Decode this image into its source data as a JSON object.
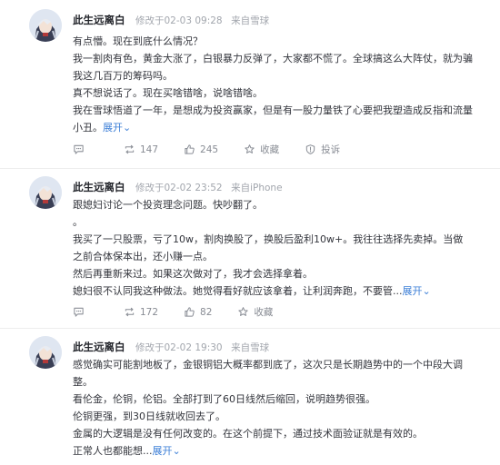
{
  "posts": [
    {
      "author": "此生远离白",
      "time": "修改于02-03 09:28",
      "source": "来自雪球",
      "lines": [
        "有点懵。现在到底什么情况？",
        "我一割肉有色，黄金大涨了，白银暴力反弹了，大家都不慌了。全球搞这么大阵仗，就为骗我这几百万的筹码吗。",
        "真不想说话了。现在买啥错啥，说啥错啥。",
        "我在雪球悟道了一年，是想成为投资赢家，但是有一股力量铁了心要把我塑造成反指和流量小丑。"
      ],
      "expand": "展开",
      "comments": "",
      "reposts": "147",
      "likes": "245",
      "favorite": "收藏",
      "report": "投诉"
    },
    {
      "author": "此生远离白",
      "time": "修改于02-02 23:52",
      "source": "来自iPhone",
      "lines": [
        "跟媳妇讨论一个投资理念问题。快吵翻了。",
        "。",
        "我买了一只股票，亏了10w，割肉换股了，换股后盈利10w+。我往往选择先卖掉。当做之前合体保本出，还小赚一点。",
        "然后再重新来过。如果这次做对了，我才会选择拿着。",
        "媳妇很不认同我这种做法。她觉得看好就应该拿着，让利润奔跑，不要管..."
      ],
      "expand": "展开",
      "comments": "",
      "reposts": "172",
      "likes": "82",
      "favorite": "收藏"
    },
    {
      "author": "此生远离白",
      "time": "修改于02-02 19:30",
      "source": "来自雪球",
      "lines": [
        "感觉确实可能割地板了，金银铜铝大概率都到底了，这次只是长期趋势中的一个中段大调整。",
        "看伦金，伦铜，伦铝。全部打到了60日线然后缩回，说明趋势很强。",
        "伦铜更强，到30日线就收回去了。",
        "金属的大逻辑是没有任何改变的。在这个前提下，通过技术面验证就是有效的。",
        "正常人也都能想..."
      ],
      "expand": "展开"
    }
  ],
  "icons": {
    "avatar": "anime-avatar",
    "comment": "comment-icon",
    "repost": "repost-icon",
    "like": "like-icon",
    "favorite": "star-icon",
    "report": "report-icon"
  },
  "colors": {
    "link": "#3d7fd7",
    "meta": "#a2a6ad",
    "text": "#33353c"
  }
}
